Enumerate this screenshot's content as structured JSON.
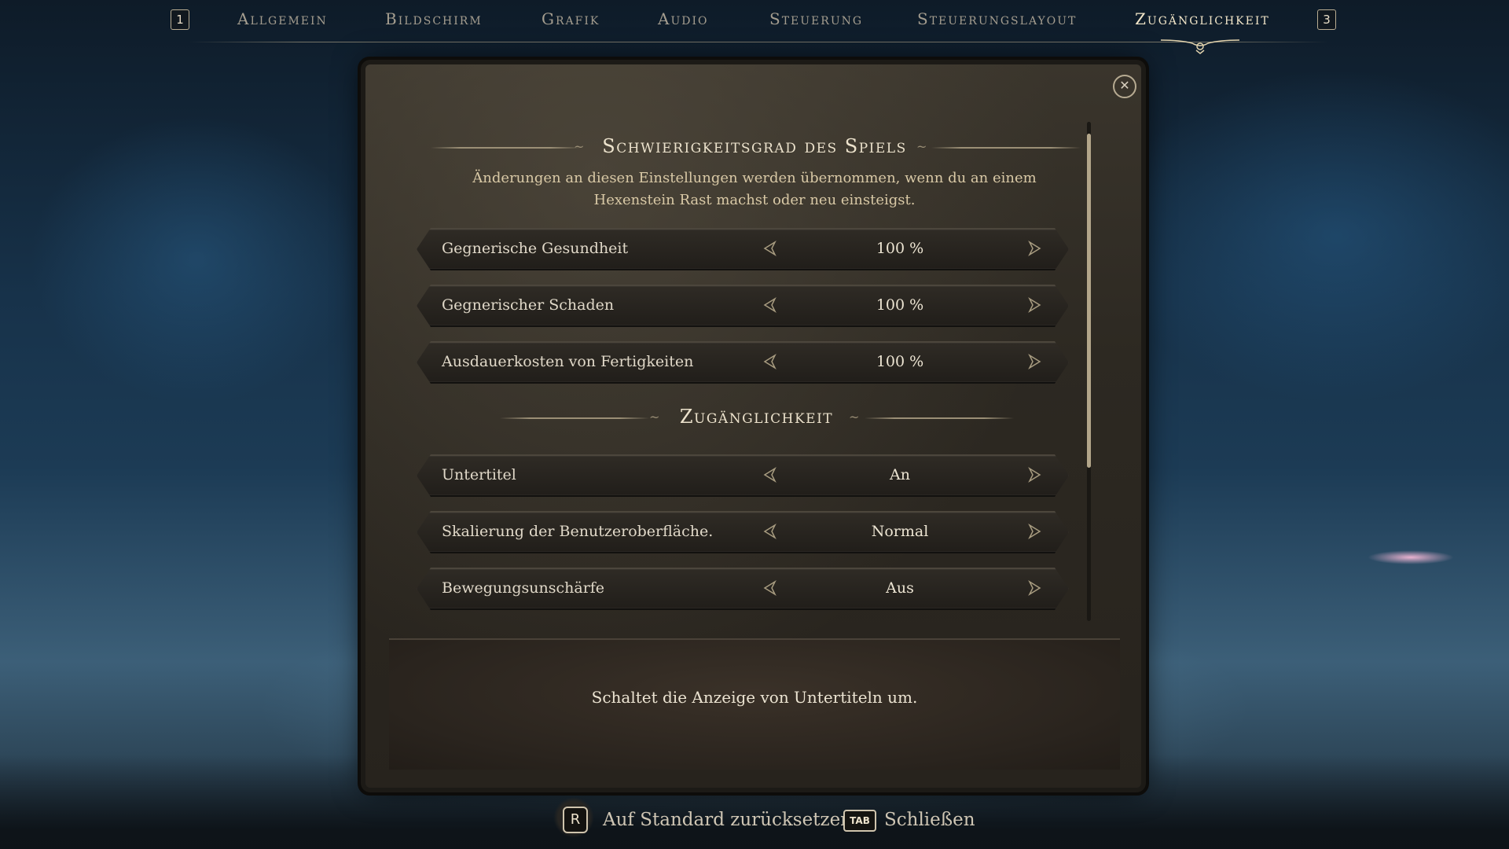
{
  "nav": {
    "prev_key": "1",
    "next_key": "3",
    "tabs": [
      {
        "label": "Allgemein"
      },
      {
        "label": "Bildschirm"
      },
      {
        "label": "Grafik"
      },
      {
        "label": "Audio"
      },
      {
        "label": "Steuerung"
      },
      {
        "label": "Steuerungslayout"
      },
      {
        "label": "Zugänglichkeit"
      }
    ],
    "active_tab": "Zugänglichkeit"
  },
  "panel": {
    "close_glyph": "✕",
    "difficulty": {
      "title": "Schwierigkeitsgrad des Spiels",
      "description": "Änderungen an diesen Einstellungen werden übernommen, wenn du an einem Hexenstein Rast machst oder neu einsteigst.",
      "settings": [
        {
          "label": "Gegnerische Gesundheit",
          "value": "100 %"
        },
        {
          "label": "Gegnerischer Schaden",
          "value": "100 %"
        },
        {
          "label": "Ausdauerkosten von Fertigkeiten",
          "value": "100 %"
        }
      ]
    },
    "accessibility": {
      "title": "Zugänglichkeit",
      "settings": [
        {
          "label": "Untertitel",
          "value": "An"
        },
        {
          "label": "Skalierung der Benutzeroberfläche.",
          "value": "Normal"
        },
        {
          "label": "Bewegungsunschärfe",
          "value": "Aus"
        }
      ]
    },
    "info_text": "Schaltet die Anzeige von Untertiteln um."
  },
  "footer": {
    "reset_key": "R",
    "reset_label": "Auf Standard zurücksetzen",
    "close_key": "TAB",
    "close_label": "Schließen"
  },
  "icons": {
    "arrow_left": "chevron-left-icon",
    "arrow_right": "chevron-right-icon",
    "close": "close-icon"
  }
}
